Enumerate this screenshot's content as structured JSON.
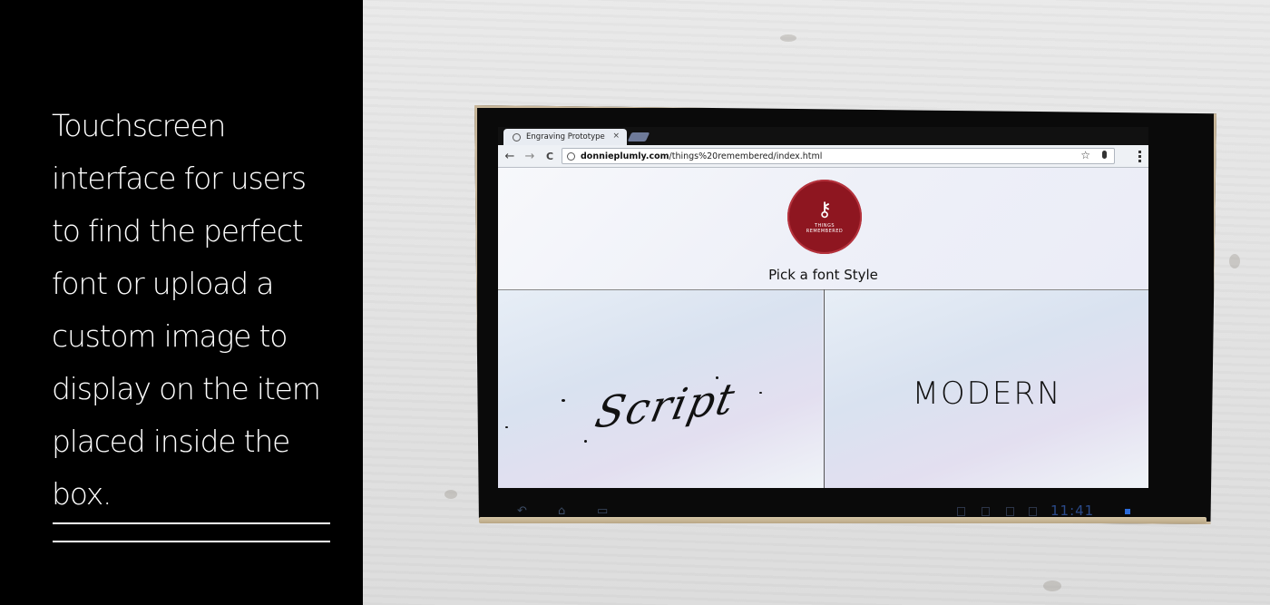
{
  "caption": {
    "lines": [
      "Touchscreen",
      "interface for users",
      "to find the perfect",
      "font or upload a",
      "custom image to",
      "display on the item",
      "placed inside the",
      "box."
    ]
  },
  "browser": {
    "tab_title": "Engraving Prototype",
    "tab_close": "×",
    "back_label": "←",
    "forward_label": "→",
    "reload_label": "C",
    "url_domain": "donnieplumly.com",
    "url_path": "/things%20remembered/index.html",
    "star_label": "☆"
  },
  "page": {
    "logo_text": "THINGS REMEMBERED",
    "heading": "Pick a font Style",
    "options": [
      {
        "label": "Script"
      },
      {
        "label": "MODERN"
      }
    ]
  },
  "system_bar": {
    "back": "↶",
    "home": "⌂",
    "recent": "▭",
    "clock": "11:41"
  },
  "colors": {
    "logo_red": "#8e1620",
    "left_panel": "#000000",
    "clock_blue": "#2a4a8a"
  }
}
